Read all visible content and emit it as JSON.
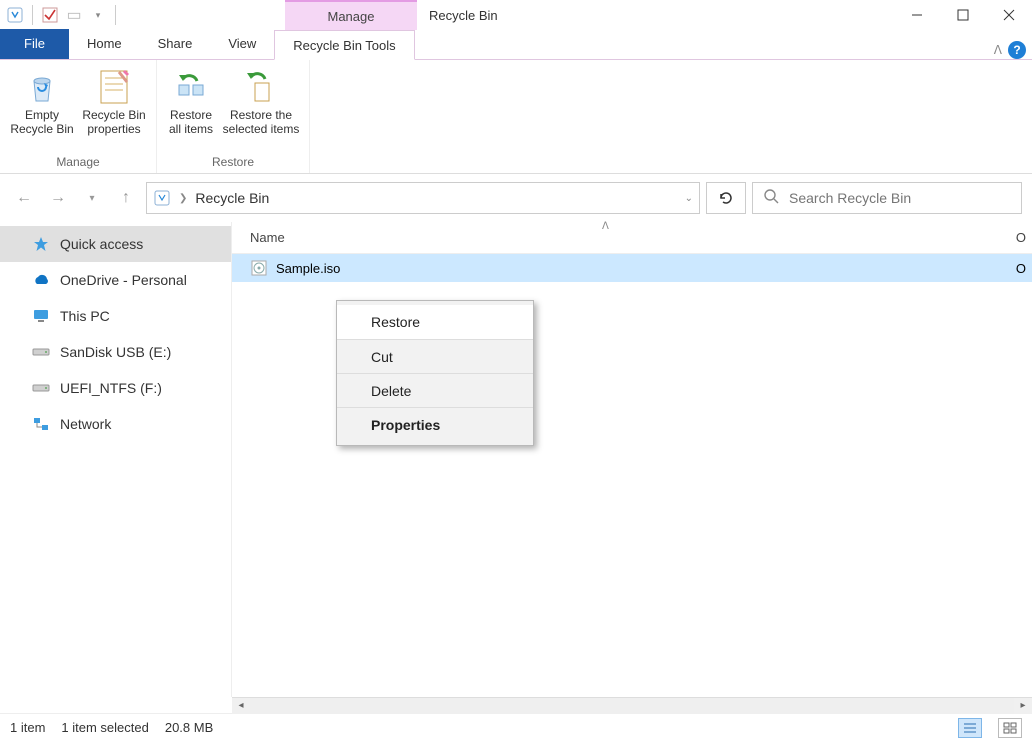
{
  "titlebar": {
    "contextual_tab": "Manage",
    "window_title": "Recycle Bin"
  },
  "tabs": {
    "file": "File",
    "home": "Home",
    "share": "Share",
    "view": "View",
    "tools": "Recycle Bin Tools"
  },
  "ribbon": {
    "manage": {
      "empty": "Empty Recycle Bin",
      "props": "Recycle Bin properties",
      "group_label": "Manage"
    },
    "restore": {
      "all": "Restore all items",
      "selected": "Restore the selected items",
      "group_label": "Restore"
    }
  },
  "address": {
    "crumb": "Recycle Bin"
  },
  "search": {
    "placeholder": "Search Recycle Bin"
  },
  "columns": {
    "name": "Name",
    "right": "O"
  },
  "sidebar": {
    "items": [
      {
        "label": "Quick access"
      },
      {
        "label": "OneDrive - Personal"
      },
      {
        "label": "This PC"
      },
      {
        "label": "SanDisk USB (E:)"
      },
      {
        "label": "UEFI_NTFS (F:)"
      },
      {
        "label": "Network"
      }
    ]
  },
  "files": [
    {
      "name": "Sample.iso",
      "right": "O"
    }
  ],
  "context_menu": {
    "restore": "Restore",
    "cut": "Cut",
    "delete": "Delete",
    "properties": "Properties"
  },
  "status": {
    "count": "1 item",
    "selected": "1 item selected",
    "size": "20.8 MB"
  }
}
